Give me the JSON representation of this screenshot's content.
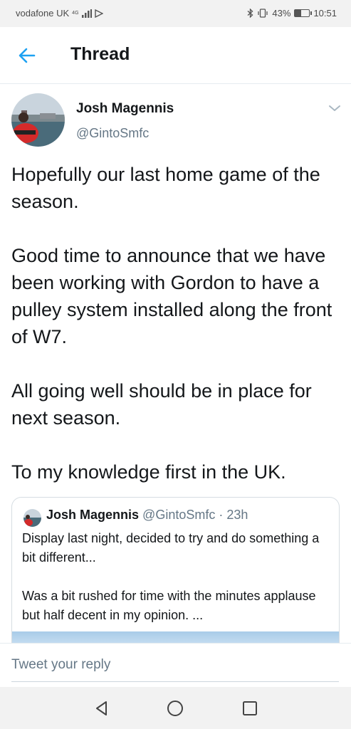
{
  "status_bar": {
    "carrier": "vodafone UK",
    "network": "4G",
    "battery_percent": "43%",
    "battery_level": 0.43,
    "time": "10:51"
  },
  "header": {
    "title": "Thread",
    "back_icon": "arrow-left-icon"
  },
  "tweet": {
    "author_name": "Josh Magennis",
    "author_handle": "@GintoSmfc",
    "paragraphs": [
      "Hopefully our last home game of the season.",
      "Good time to announce that we have been working with Gordon to have a pulley system installed along the front of W7.",
      "All going well should be in place for next season.",
      "To my knowledge first in the UK."
    ],
    "quote": {
      "author_name": "Josh Magennis",
      "meta": "@GintoSmfc · 23h",
      "paragraphs": [
        "Display last night, decided to try and do something a bit different...",
        "Was a bit rushed for time with the minutes applause but half decent in my opinion. ..."
      ]
    }
  },
  "reply": {
    "placeholder": "Tweet your reply"
  },
  "colors": {
    "accent": "#1da1f2",
    "text": "#14171a",
    "secondary": "#657786"
  },
  "nav_icons": [
    "back-triangle-icon",
    "home-circle-icon",
    "recents-square-icon"
  ]
}
